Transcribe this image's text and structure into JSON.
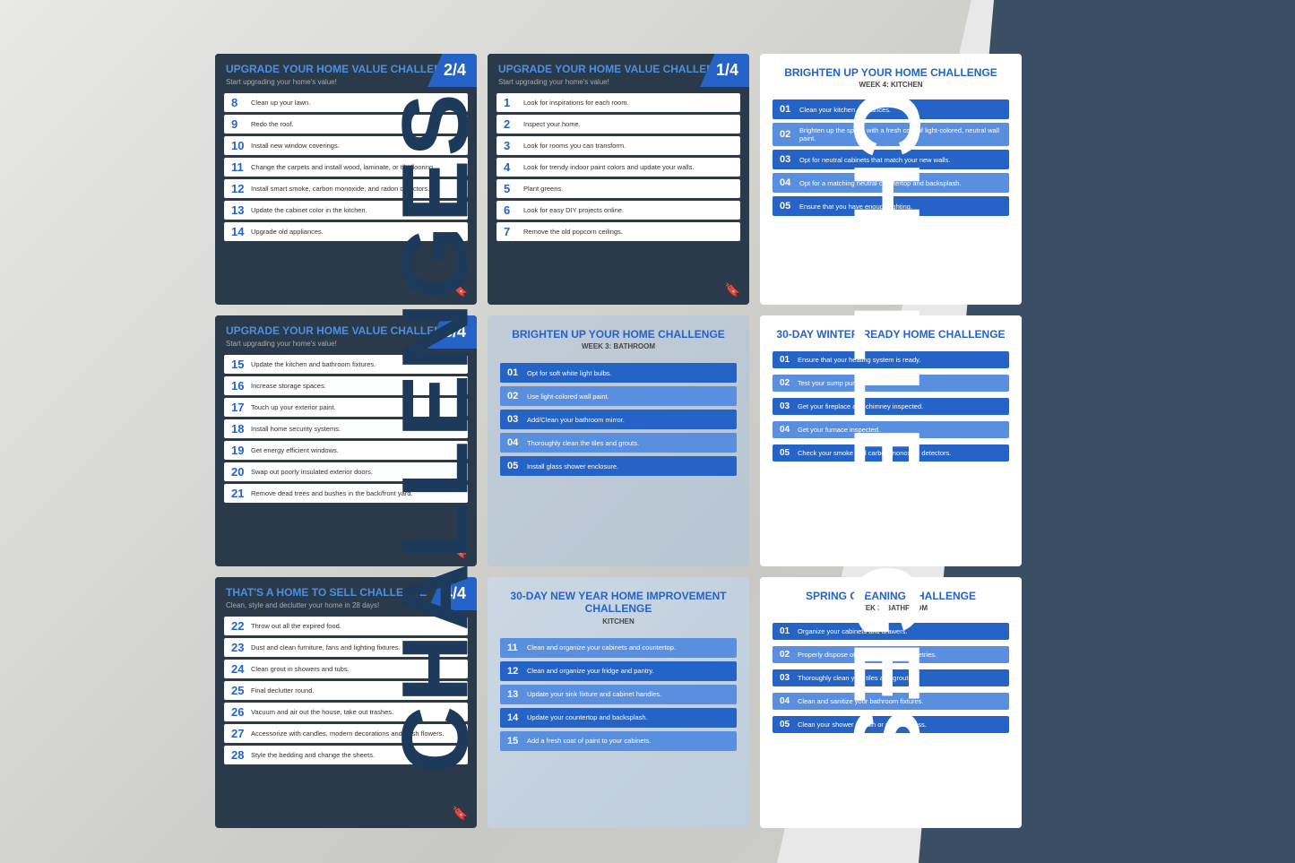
{
  "background": {
    "left_text": "CHALLENGES",
    "right_text": "CHALLENGES"
  },
  "cards": {
    "card1": {
      "title": "UPGRADE YOUR HOME VALUE CHALLENGE",
      "badge": "2/4",
      "subtitle": "Start upgrading your home's value!",
      "items": [
        {
          "num": "8",
          "text": "Clean up your lawn."
        },
        {
          "num": "9",
          "text": "Redo the roof."
        },
        {
          "num": "10",
          "text": "Install new window coverings."
        },
        {
          "num": "11",
          "text": "Change the carpets and install wood, laminate, or tile flooring."
        },
        {
          "num": "12",
          "text": "Install smart smoke, carbon monoxide, and radon detectors."
        },
        {
          "num": "13",
          "text": "Update the cabinet color in the kitchen."
        },
        {
          "num": "14",
          "text": "Upgrade old appliances."
        }
      ]
    },
    "card2": {
      "title": "UPGRADE YOUR HOME VALUE CHALLENGE",
      "badge": "1/4",
      "subtitle": "Start upgrading your home's value!",
      "items": [
        {
          "num": "1",
          "text": "Look for inspirations for each room."
        },
        {
          "num": "2",
          "text": "Inspect your home."
        },
        {
          "num": "3",
          "text": "Look for rooms you can transform."
        },
        {
          "num": "4",
          "text": "Look for trendy indoor paint colors and update your walls."
        },
        {
          "num": "5",
          "text": "Plant greens."
        },
        {
          "num": "6",
          "text": "Look for easy DIY projects online."
        },
        {
          "num": "7",
          "text": "Remove the old popcorn ceilings."
        }
      ]
    },
    "card3": {
      "title": "BRIGHTEN UP YOUR HOME CHALLENGE",
      "subtitle": "WEEK 4: KITCHEN",
      "items": [
        {
          "num": "01",
          "text": "Clean your kitchen appliances."
        },
        {
          "num": "02",
          "text": "Brighten up the space with a fresh coat of light-colored, neutral wall paint."
        },
        {
          "num": "03",
          "text": "Opt for neutral cabinets that match your new walls."
        },
        {
          "num": "04",
          "text": "Opt for a matching neutral countertop and backsplash."
        },
        {
          "num": "05",
          "text": "Ensure that you have enough lighting."
        }
      ]
    },
    "card4": {
      "title": "UPGRADE YOUR HOME VALUE CHALLENGE",
      "badge": "3/4",
      "subtitle": "Start upgrading your home's value!",
      "items": [
        {
          "num": "15",
          "text": "Update the kitchen and bathroom fixtures."
        },
        {
          "num": "16",
          "text": "Increase storage spaces."
        },
        {
          "num": "17",
          "text": "Touch up your exterior paint."
        },
        {
          "num": "18",
          "text": "Install home security systems."
        },
        {
          "num": "19",
          "text": "Get energy efficient windows."
        },
        {
          "num": "20",
          "text": "Swap out poorly insulated exterior doors."
        },
        {
          "num": "21",
          "text": "Remove dead trees and bushes in the back/front yard."
        }
      ]
    },
    "card5": {
      "title": "BRIGHTEN UP YOUR HOME CHALLENGE",
      "subtitle": "WEEK 3: BATHROOM",
      "items": [
        {
          "num": "01",
          "text": "Opt for soft white light bulbs."
        },
        {
          "num": "02",
          "text": "Use light-colored wall paint."
        },
        {
          "num": "03",
          "text": "Add/Clean your bathroom mirror."
        },
        {
          "num": "04",
          "text": "Thoroughly clean the tiles and grouts."
        },
        {
          "num": "05",
          "text": "Install glass shower enclosure."
        }
      ]
    },
    "card6": {
      "title": "30-DAY WINTER-READY HOME CHALLENGE",
      "items": [
        {
          "num": "01",
          "text": "Ensure that your heating system is ready."
        },
        {
          "num": "02",
          "text": "Test your sump pump."
        },
        {
          "num": "03",
          "text": "Get your fireplace and chimney inspected."
        },
        {
          "num": "04",
          "text": "Get your furnace inspected."
        },
        {
          "num": "05",
          "text": "Check your smoke and carbon monoxide detectors."
        }
      ]
    },
    "card7": {
      "title": "THAT'S A HOME TO SELL CHALLENGE",
      "badge": "4/4",
      "subtitle": "Clean, style and declutter your home in 28 days!",
      "items": [
        {
          "num": "22",
          "text": "Throw out all the expired food."
        },
        {
          "num": "23",
          "text": "Dust and clean furniture, fans and lighting fixtures."
        },
        {
          "num": "24",
          "text": "Clean grout in showers and tubs."
        },
        {
          "num": "25",
          "text": "Final declutter round."
        },
        {
          "num": "26",
          "text": "Vacuum and air out the house, take out trashes."
        },
        {
          "num": "27",
          "text": "Accessorize with candles, modern decorations and fresh flowers."
        },
        {
          "num": "28",
          "text": "Style the bedding and change the sheets."
        }
      ]
    },
    "card8": {
      "title": "30-DAY NEW YEAR HOME IMPROVEMENT CHALLENGE",
      "subtitle": "KITCHEN",
      "items": [
        {
          "num": "11",
          "text": "Clean and organize your cabinets and countertop."
        },
        {
          "num": "12",
          "text": "Clean and organize your fridge and pantry."
        },
        {
          "num": "13",
          "text": "Update your sink fixture and cabinet handles."
        },
        {
          "num": "14",
          "text": "Update your countertop and backsplash."
        },
        {
          "num": "15",
          "text": "Add a fresh coat of paint to your cabinets."
        }
      ]
    },
    "card9": {
      "title": "SPRING CLEANING CHALLENGE",
      "subtitle": "WEEK 3: BATHROOM",
      "items": [
        {
          "num": "01",
          "text": "Organize your cabinets and drawers."
        },
        {
          "num": "02",
          "text": "Properly dispose of old medicine and toiletries."
        },
        {
          "num": "03",
          "text": "Thoroughly clean your tiles and grout."
        },
        {
          "num": "04",
          "text": "Clean and sanitize your bathroom fixtures."
        },
        {
          "num": "05",
          "text": "Clean your shower curtain or shower glass."
        }
      ]
    }
  }
}
